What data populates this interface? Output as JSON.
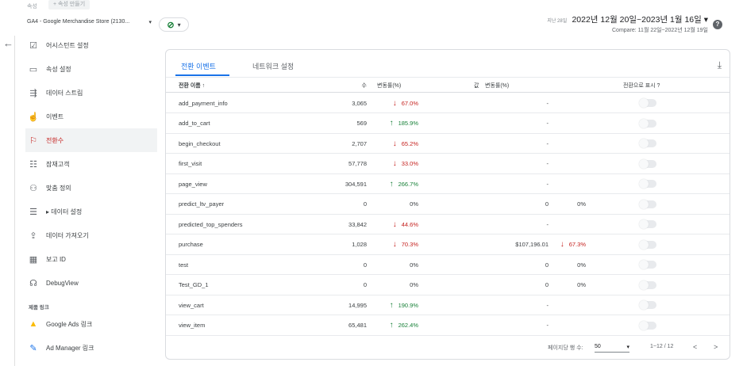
{
  "header": {
    "property_label": "속성",
    "create_property": "+ 속성 만들기",
    "property_select": "GA4 - Google Merchandise Store (2130...",
    "check_dropdown": "▾",
    "date_last_label": "지난 28일",
    "date_main": "2022년 12월 20일~2023년 1월 16일 ▾",
    "date_compare": "Compare: 11월 22일~2022년 12월 19일"
  },
  "sidebar": {
    "items": [
      {
        "icon": "☑",
        "label": "어시스턴트 설정"
      },
      {
        "icon": "▭",
        "label": "속성 설정"
      },
      {
        "icon": "⇶",
        "label": "데이터 스트림"
      },
      {
        "icon": "☝",
        "label": "이벤트"
      },
      {
        "icon": "⚐",
        "label": "전환수"
      },
      {
        "icon": "☷",
        "label": "잠재고객"
      },
      {
        "icon": "⚇",
        "label": "맞춤 정의"
      },
      {
        "icon": "☰",
        "label": "▸ 데이터 설정"
      },
      {
        "icon": "⇪",
        "label": "데이터 가져오기"
      },
      {
        "icon": "▦",
        "label": "보고 ID"
      },
      {
        "icon": "☊",
        "label": "DebugView"
      }
    ],
    "section_label": "제품 링크",
    "links": [
      {
        "icon": "▲",
        "label": "Google Ads 링크",
        "color": "#fbbc04"
      },
      {
        "icon": "✎",
        "label": "Ad Manager 링크",
        "color": "#1a73e8"
      }
    ]
  },
  "card": {
    "tabs": [
      "전환 이벤트",
      "네트워크 설정"
    ],
    "columns": {
      "name": "전환 이름 ↑",
      "count": "수",
      "change1": "변동률(%)",
      "value": "값",
      "change2": "변동률(%)",
      "toggle": "전환으로 표시 ?"
    },
    "rows": [
      {
        "name": "add_payment_info",
        "count": "3,065",
        "chg1": "67.0%",
        "dir1": "down",
        "value": "-",
        "chg2": "",
        "dir2": ""
      },
      {
        "name": "add_to_cart",
        "count": "569",
        "chg1": "185.9%",
        "dir1": "up",
        "value": "-",
        "chg2": "",
        "dir2": ""
      },
      {
        "name": "begin_checkout",
        "count": "2,707",
        "chg1": "65.2%",
        "dir1": "down",
        "value": "-",
        "chg2": "",
        "dir2": ""
      },
      {
        "name": "first_visit",
        "count": "57,778",
        "chg1": "33.0%",
        "dir1": "down",
        "value": "-",
        "chg2": "",
        "dir2": ""
      },
      {
        "name": "page_view",
        "count": "304,591",
        "chg1": "266.7%",
        "dir1": "up",
        "value": "-",
        "chg2": "",
        "dir2": ""
      },
      {
        "name": "predict_ltv_payer",
        "count": "0",
        "chg1": "0%",
        "dir1": "",
        "value": "0",
        "chg2": "0%",
        "dir2": ""
      },
      {
        "name": "predicted_top_spenders",
        "count": "33,842",
        "chg1": "44.6%",
        "dir1": "down",
        "value": "-",
        "chg2": "",
        "dir2": ""
      },
      {
        "name": "purchase",
        "count": "1,028",
        "chg1": "70.3%",
        "dir1": "down",
        "value": "$107,196.01",
        "chg2": "67.3%",
        "dir2": "down"
      },
      {
        "name": "test",
        "count": "0",
        "chg1": "0%",
        "dir1": "",
        "value": "0",
        "chg2": "0%",
        "dir2": ""
      },
      {
        "name": "Test_GD_1",
        "count": "0",
        "chg1": "0%",
        "dir1": "",
        "value": "0",
        "chg2": "0%",
        "dir2": ""
      },
      {
        "name": "view_cart",
        "count": "14,995",
        "chg1": "190.9%",
        "dir1": "up",
        "value": "-",
        "chg2": "",
        "dir2": ""
      },
      {
        "name": "view_item",
        "count": "65,481",
        "chg1": "262.4%",
        "dir1": "up",
        "value": "-",
        "chg2": "",
        "dir2": ""
      }
    ],
    "footer": {
      "rows_per_page_label": "페이지당 행 수:",
      "rows_per_page": "50",
      "range": "1~12 / 12",
      "prev": "<",
      "next": ">"
    }
  },
  "colors": {
    "accent": "#1a73e8",
    "up": "#188038",
    "down": "#c5221f"
  }
}
